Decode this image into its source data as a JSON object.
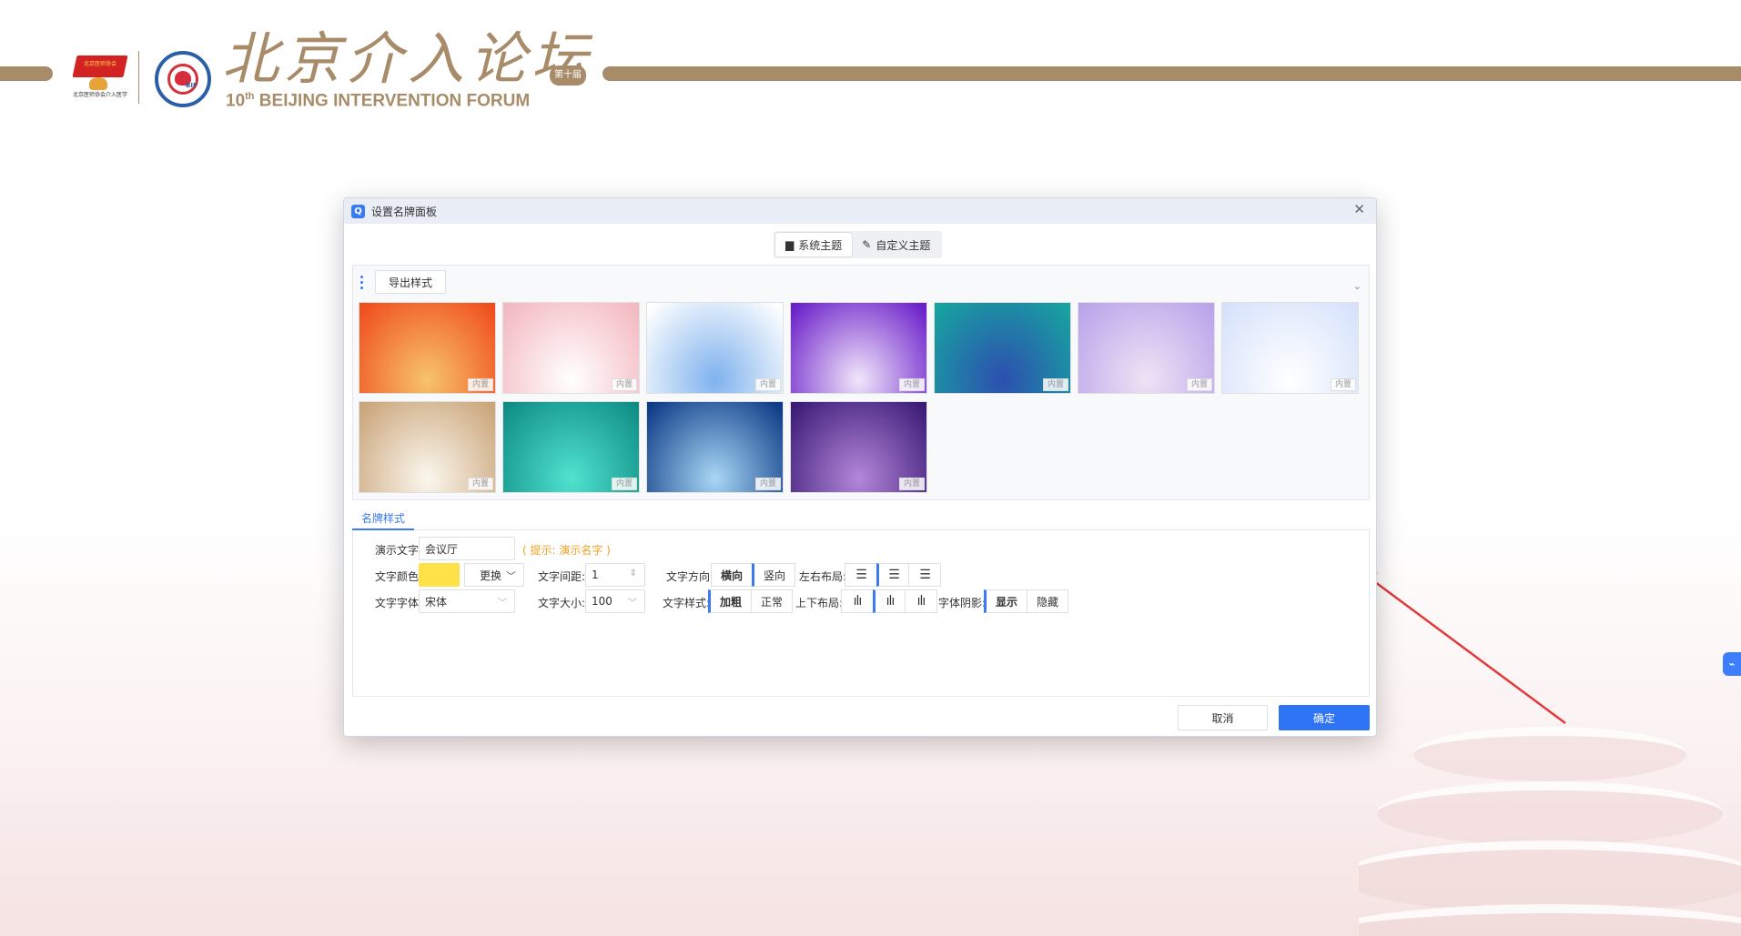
{
  "banner": {
    "org_flag_text": "北京医师协会",
    "org_caption": "北京医师协会介入医学",
    "emblem_text": "BIF",
    "title_cn": "北京介入论坛",
    "seal_text": "第十届",
    "title_en_num": "10",
    "title_en_sup": "th",
    "title_en_rest": " BEIJING INTERVENTION FORUM"
  },
  "dialog": {
    "app_icon": "Q",
    "title": "设置名牌面板",
    "close_symbol": "✕",
    "theme_tabs": [
      {
        "icon": "monitor-icon",
        "glyph": "▆",
        "label": "系统主题",
        "active": true
      },
      {
        "icon": "pencil-icon",
        "glyph": "✎",
        "label": "自定义主题",
        "active": false
      }
    ],
    "export_label": "导出样式",
    "collapse_glyph": "⌄",
    "thumbnail_badge": "内置",
    "thumbnails": [
      {
        "from": "#f04d1e",
        "to": "#f7c46a"
      },
      {
        "from": "#f3b8c0",
        "to": "#ffffff"
      },
      {
        "from": "#ffffff",
        "to": "#7fb2ee"
      },
      {
        "from": "#6a1fc9",
        "to": "#f1e6fb"
      },
      {
        "from": "#17a3a0",
        "to": "#2d4fb0"
      },
      {
        "from": "#b9a4ea",
        "to": "#f0e2f5"
      },
      {
        "from": "#d6e2fb",
        "to": "#ffffff"
      },
      {
        "from": "#caa57a",
        "to": "#fbf7ee"
      },
      {
        "from": "#0f8d85",
        "to": "#50e2cf"
      },
      {
        "from": "#0e3b86",
        "to": "#a8d7f5"
      },
      {
        "from": "#3b1b77",
        "to": "#b487d9"
      }
    ],
    "style_tab": "名牌样式",
    "form": {
      "demo_text_label": "演示文字:",
      "demo_text_value": "会议厅",
      "demo_hint": "( 提示: 演示名字 )",
      "color_label": "文字颜色:",
      "color_value": "#ffe14a",
      "change_label": "更换",
      "spacing_label": "文字间距:",
      "spacing_value": "1",
      "direction_label": "文字方向:",
      "direction_options": [
        "横向",
        "竖向"
      ],
      "h_layout_label": "左右布局:",
      "font_label": "文字字体:",
      "font_value": "宋体",
      "size_label": "文字大小:",
      "size_value": "100",
      "weight_label": "文字样式:",
      "weight_options": [
        "加粗",
        "正常"
      ],
      "v_layout_label": "上下布局:",
      "shadow_label": "字体阴影:",
      "shadow_options": [
        "显示",
        "隐藏"
      ]
    },
    "cancel_label": "取消",
    "ok_label": "确定"
  },
  "side_widget_glyph": "⌁"
}
